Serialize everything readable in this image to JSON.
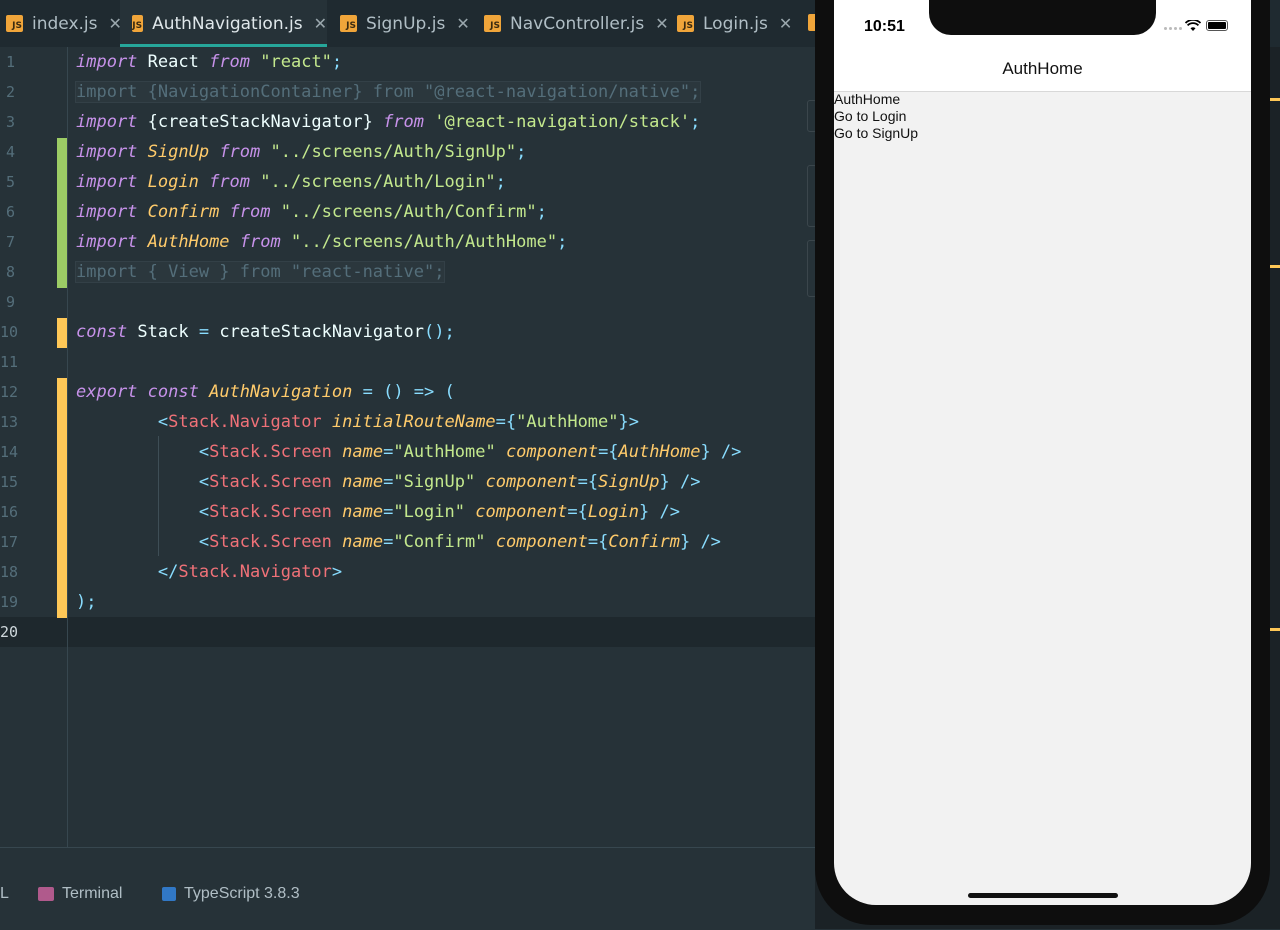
{
  "tabs": [
    {
      "label": "index.js",
      "active": false
    },
    {
      "label": "AuthNavigation.js",
      "active": true
    },
    {
      "label": "SignUp.js",
      "active": false
    },
    {
      "label": "NavController.js",
      "active": false
    },
    {
      "label": "Login.js",
      "active": false
    }
  ],
  "file_icon_text": "JS",
  "close_glyph": "✕",
  "line_numbers": [
    "1",
    "2",
    "3",
    "4",
    "5",
    "6",
    "7",
    "8",
    "9",
    "10",
    "11",
    "12",
    "13",
    "14",
    "15",
    "16",
    "17",
    "18",
    "19",
    "20"
  ],
  "code": {
    "l1": {
      "import": "import",
      "name": " React ",
      "from": "from",
      "src": " \"react\"",
      "semi": ";"
    },
    "l2": {
      "text": "import {NavigationContainer} from \"@react-navigation/native\";"
    },
    "l3": {
      "import": "import",
      "name": " {createStackNavigator} ",
      "from": "from",
      "src": " '@react-navigation/stack'",
      "semi": ";"
    },
    "l4": {
      "import": "import",
      "name": " SignUp ",
      "from": "from",
      "src": " \"../screens/Auth/SignUp\"",
      "semi": ";"
    },
    "l5": {
      "import": "import",
      "name": " Login ",
      "from": "from",
      "src": " \"../screens/Auth/Login\"",
      "semi": ";"
    },
    "l6": {
      "import": "import",
      "name": " Confirm ",
      "from": "from",
      "src": " \"../screens/Auth/Confirm\"",
      "semi": ";"
    },
    "l7": {
      "import": "import",
      "name": " AuthHome ",
      "from": "from",
      "src": " \"../screens/Auth/AuthHome\"",
      "semi": ";"
    },
    "l8": {
      "text": "import { View } from \"react-native\";"
    },
    "l10": {
      "const": "const",
      "name": " Stack ",
      "eq": "=",
      "fn": " createStackNavigator",
      "rest": "();"
    },
    "l12": {
      "export": "export",
      "const": " const",
      "name": " AuthNavigation",
      "rest": " = () => ("
    },
    "l13": {
      "indent": "        ",
      "open": "<",
      "tag": "Stack.Navigator",
      "attr": " initialRouteName",
      "eq": "={",
      "val": "\"AuthHome\"",
      "close": "}>"
    },
    "screens": [
      {
        "name": "\"AuthHome\"",
        "component": "AuthHome"
      },
      {
        "name": "\"SignUp\"",
        "component": "SignUp"
      },
      {
        "name": "\"Login\"",
        "component": "Login"
      },
      {
        "name": "\"Confirm\"",
        "component": "Confirm"
      }
    ],
    "screen_tag": "Stack.Screen",
    "screen_name_attr": " name",
    "screen_comp_attr": " component",
    "l18": {
      "indent": "        ",
      "open": "</",
      "tag": "Stack.Navigator",
      "close": ">"
    },
    "l19": {
      "text": ");"
    }
  },
  "bottom_tools": [
    {
      "label": "L"
    },
    {
      "label": "Terminal"
    },
    {
      "label": "TypeScript 3.8.3"
    }
  ],
  "simulator": {
    "time": "10:51",
    "nav_title": "AuthHome",
    "lines": [
      "AuthHome",
      "Go to Login",
      "Go to SignUp"
    ]
  },
  "colors": {
    "keyword": "#c792ea",
    "string": "#c3e88d",
    "component": "#ffcb6b",
    "tag": "#f07178",
    "function": "#82aaff",
    "modified_marker": "#ffc857",
    "added_marker": "#9ccc65",
    "tab_accent": "#26a69a"
  }
}
